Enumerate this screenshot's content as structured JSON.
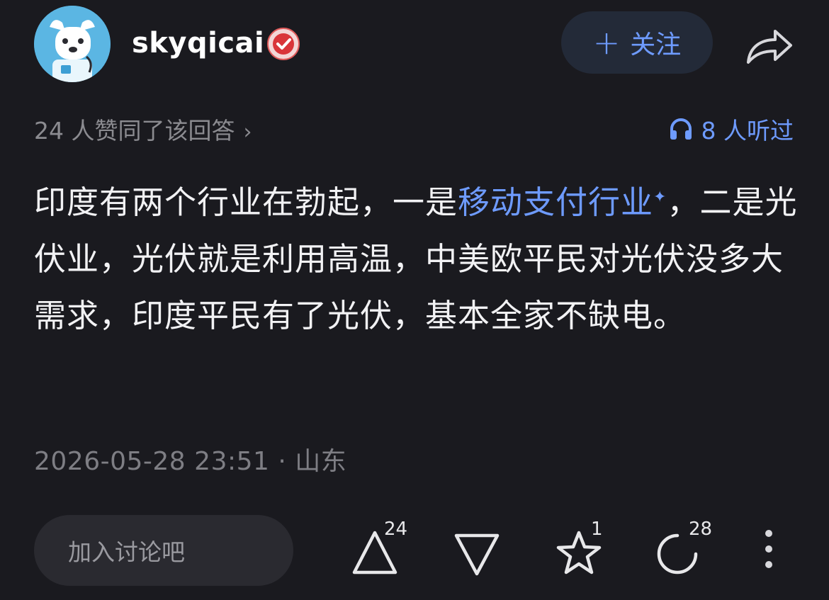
{
  "author": {
    "username": "skyqicai",
    "avatar_icon": "avatar-cartoon-dog-icon",
    "badge_icon": "verified-badge-icon"
  },
  "header": {
    "follow_plus": "+",
    "follow_label": "关注",
    "share_icon": "share-icon"
  },
  "meta": {
    "likes_text": "24 人赞同了该回答",
    "likes_chevron": "›",
    "listened_text": "8 人听过",
    "listened_icon": "headphones-icon"
  },
  "answer": {
    "text_before_link": "印度有两个行业在勃起，一是",
    "link_text": "移动支付行业",
    "link_mark": "✦",
    "text_after_link": "，二是光伏业，光伏就是利用高温，中美欧平民对光伏没多大需求，印度平民有了光伏，基本全家不缺电。"
  },
  "timestamp": "2026-05-28 23:51 · 山东",
  "bottom_bar": {
    "comment_placeholder": "加入讨论吧",
    "upvote_count": "24",
    "downvote_count": "",
    "favorite_count": "1",
    "comment_count": "28",
    "upvote_icon": "upvote-triangle-icon",
    "downvote_icon": "downvote-triangle-icon",
    "favorite_icon": "star-icon",
    "comment_icon": "comment-bubble-icon",
    "more_icon": "more-vertical-icon"
  },
  "colors": {
    "background": "#1a1a1f",
    "accent": "#6e9bff",
    "secondary_text": "#8b8b90",
    "primary_text": "#f2f2f4"
  }
}
